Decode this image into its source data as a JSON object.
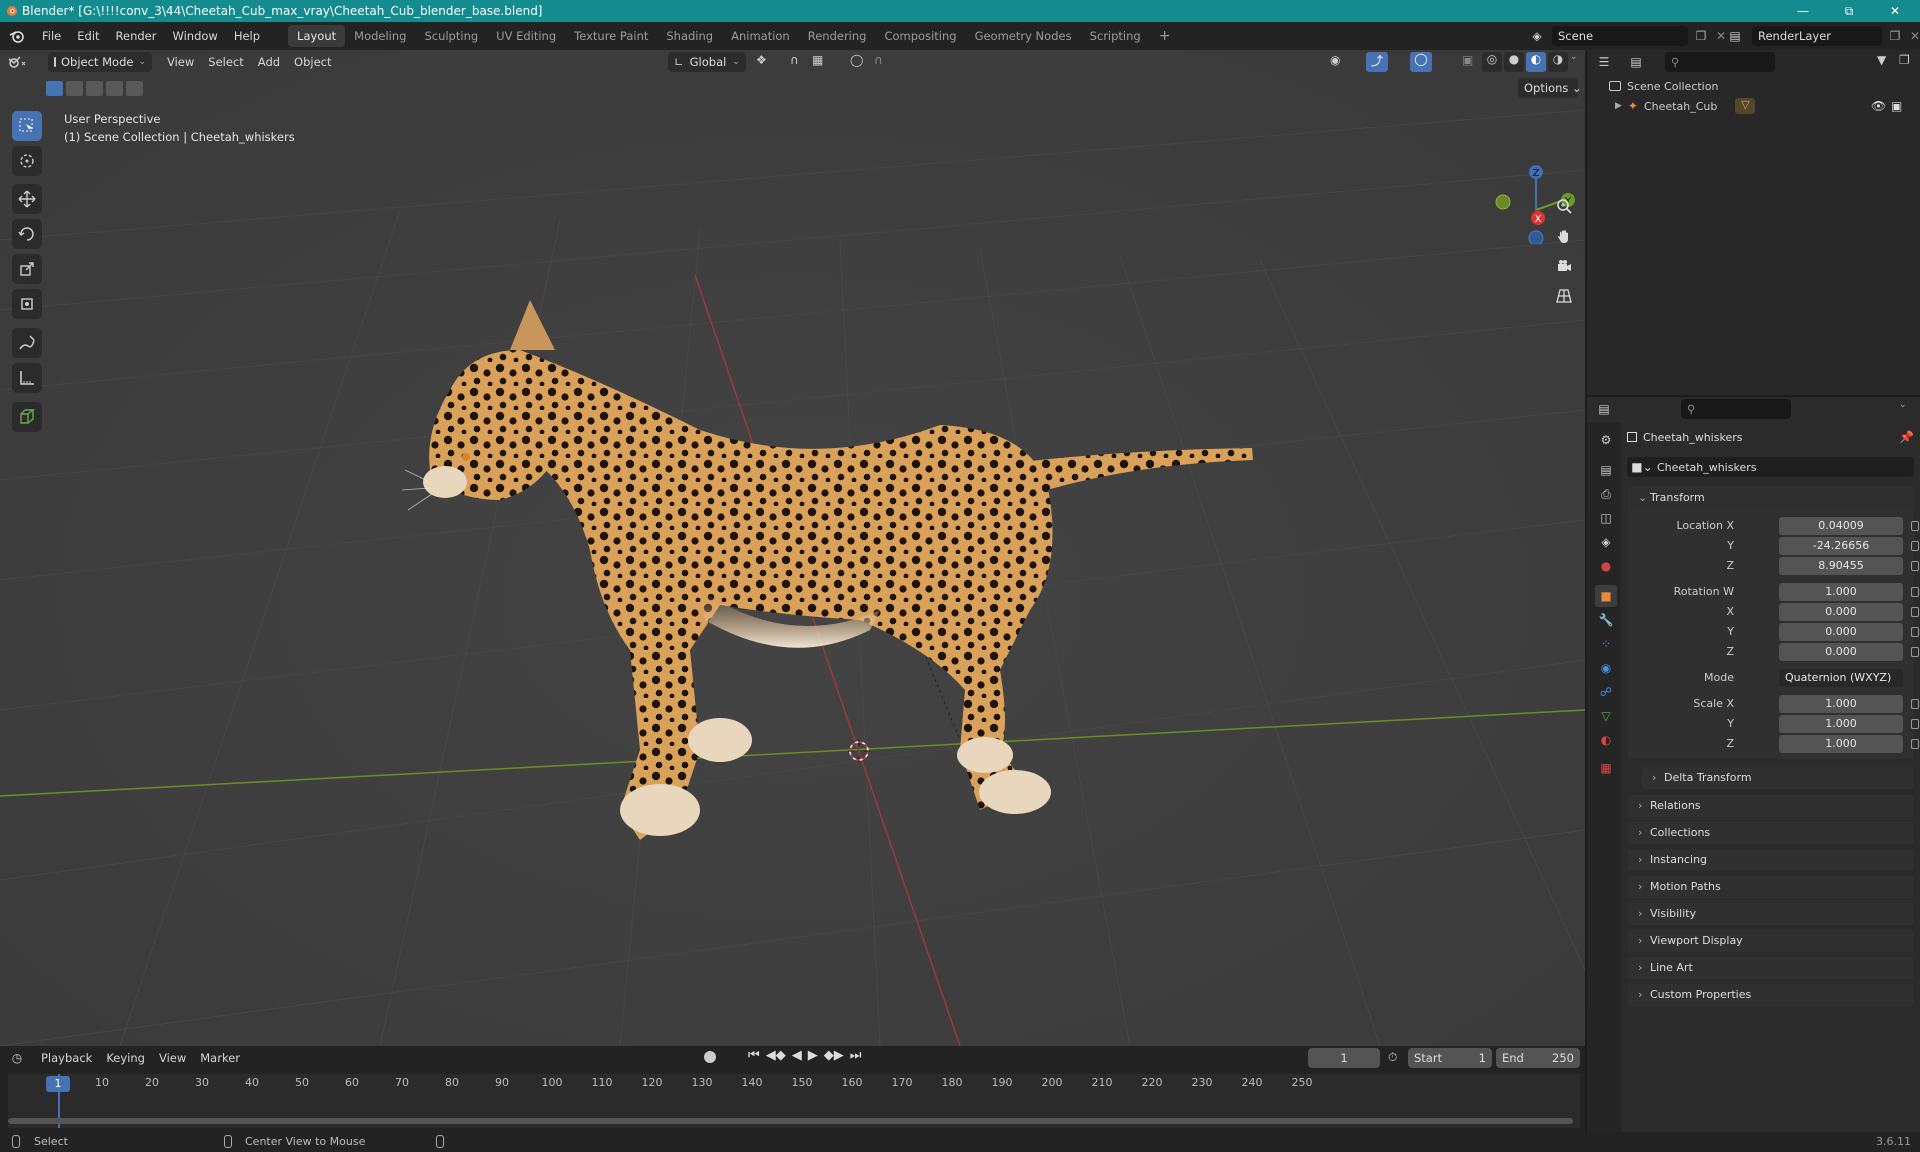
{
  "window": {
    "title": "Blender* [G:\\!!!!conv_3\\44\\Cheetah_Cub_max_vray\\Cheetah_Cub_blender_base.blend]"
  },
  "menu": [
    "File",
    "Edit",
    "Render",
    "Window",
    "Help"
  ],
  "workspaces": [
    "Layout",
    "Modeling",
    "Sculpting",
    "UV Editing",
    "Texture Paint",
    "Shading",
    "Animation",
    "Rendering",
    "Compositing",
    "Geometry Nodes",
    "Scripting"
  ],
  "active_workspace": "Layout",
  "scene_name": "Scene",
  "view_layer": "RenderLayer",
  "viewport": {
    "mode": "Object Mode",
    "menus": [
      "View",
      "Select",
      "Add",
      "Object"
    ],
    "orientation": "Global",
    "options": "Options",
    "perspective": "User Perspective",
    "collection_info": "(1) Scene Collection | Cheetah_whiskers",
    "gizmo_labels": {
      "x": "X",
      "y": "Y",
      "z": "Z"
    }
  },
  "outliner": {
    "root": "Scene Collection",
    "items": [
      {
        "name": "Cheetah_Cub"
      }
    ]
  },
  "properties": {
    "object_name": "Cheetah_whiskers",
    "data_name": "Cheetah_whiskers",
    "transform_title": "Transform",
    "location_label": "Location X",
    "location": {
      "x": "0.04009",
      "y": "-24.26656",
      "z": "8.90455"
    },
    "rotation_label": "Rotation W",
    "rotation": {
      "w": "1.000",
      "x": "0.000",
      "y": "0.000",
      "z": "0.000"
    },
    "mode_label": "Mode",
    "mode": "Quaternion (WXYZ)",
    "scale_label": "Scale X",
    "scale": {
      "x": "1.000",
      "y": "1.000",
      "z": "1.000"
    },
    "axis_labels": {
      "x": "X",
      "y": "Y",
      "z": "Z"
    },
    "delta": "Delta Transform",
    "panels": [
      "Relations",
      "Collections",
      "Instancing",
      "Motion Paths",
      "Visibility",
      "Viewport Display",
      "Line Art",
      "Custom Properties"
    ]
  },
  "timeline": {
    "menus": [
      "Playback",
      "Keying",
      "View",
      "Marker"
    ],
    "current_frame": "1",
    "start_label": "Start",
    "start": "1",
    "end_label": "End",
    "end": "250",
    "ticks": [
      "1",
      "10",
      "20",
      "30",
      "40",
      "50",
      "60",
      "70",
      "80",
      "90",
      "100",
      "110",
      "120",
      "130",
      "140",
      "150",
      "160",
      "170",
      "180",
      "190",
      "200",
      "210",
      "220",
      "230",
      "240",
      "250"
    ]
  },
  "status": {
    "left": "Select",
    "middle": "Center View to Mouse",
    "version": "3.6.11"
  },
  "colors": {
    "title_bar": "#148b8f",
    "accent": "#4772b3",
    "grid_x_axis": "#9b3a3a",
    "grid_y_axis": "#6b8e23",
    "cheetah_fur": "#d9a15a"
  }
}
